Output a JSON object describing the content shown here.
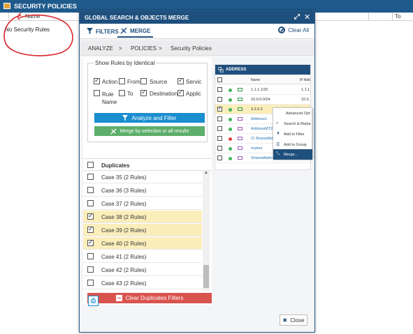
{
  "background": {
    "header_title": "SECURITY POLICIES",
    "col_name": "Name",
    "col_to": "To",
    "empty_text": "No Security Rules"
  },
  "modal": {
    "title": "GLOBAL SEARCH & OBJECTS MERGE",
    "tabs": {
      "filters": "FILTERS",
      "merge": "MERGE"
    },
    "clear_all": "Clear All",
    "breadcrumb": [
      "ANALYZE",
      ">",
      "POLICIES",
      ">",
      "Security Policies"
    ],
    "show_rules": {
      "legend": "Show Rules by Identical",
      "options": [
        {
          "label": "Action",
          "checked": true
        },
        {
          "label": "From",
          "checked": false
        },
        {
          "label": "Source",
          "checked": false
        },
        {
          "label": "Servic",
          "checked": true
        },
        {
          "label": "Rule Name",
          "checked": false
        },
        {
          "label": "To",
          "checked": false
        },
        {
          "label": "Destination",
          "checked": true
        },
        {
          "label": "Applic",
          "checked": true
        }
      ],
      "analyze_button": "Analyze and Filter",
      "merge_button": "Merge by selection or all results"
    },
    "duplicates": {
      "header": "Duplicates",
      "rows": [
        {
          "label": "Case 35 (2 Rules)",
          "checked": false
        },
        {
          "label": "Case 36 (3 Rules)",
          "checked": false
        },
        {
          "label": "Case 37 (2 Rules)",
          "checked": false
        },
        {
          "label": "Case 38 (2 Rules)",
          "checked": true
        },
        {
          "label": "Case 39 (2 Rules)",
          "checked": true
        },
        {
          "label": "Case 40 (2 Rules)",
          "checked": true
        },
        {
          "label": "Case 41 (2 Rules)",
          "checked": false
        },
        {
          "label": "Case 42 (2 Rules)",
          "checked": false
        },
        {
          "label": "Case 43 (2 Rules)",
          "checked": false
        }
      ],
      "clear_button": "Clear Duplicates Filters"
    },
    "address": {
      "header": "ADDRESS",
      "col_name": "Name",
      "col_ip": "IP Add",
      "rows": [
        {
          "name": "1.1.1.1/32",
          "ip": "1.1.1",
          "status": "green",
          "kind": "host",
          "checked": false,
          "link": false
        },
        {
          "name": "10.0.0.0/24",
          "ip": "10.0.",
          "status": "green",
          "kind": "host",
          "checked": false,
          "link": false
        },
        {
          "name": "3.3.3.3",
          "ip": "3.3.3",
          "status": "green",
          "kind": "host",
          "checked": true,
          "link": false
        },
        {
          "name": "Address1",
          "ip": "",
          "status": "green",
          "kind": "group",
          "checked": false,
          "link": true
        },
        {
          "name": "AddressMT2",
          "ip": "",
          "status": "green",
          "kind": "group",
          "checked": false,
          "link": true
        },
        {
          "name": "Cl SharedAdd",
          "ip": "",
          "status": "red",
          "kind": "group",
          "checked": false,
          "link": true
        },
        {
          "name": "mytest",
          "ip": "",
          "status": "green",
          "kind": "group",
          "checked": false,
          "link": true
        },
        {
          "name": "SharedAddres",
          "ip": "",
          "status": "green",
          "kind": "group",
          "checked": false,
          "link": true
        }
      ]
    },
    "context_menu": [
      {
        "label": "Advanced Opt",
        "icon": ""
      },
      {
        "label": "Search & Repla",
        "icon": "search-icon"
      },
      {
        "label": "Add to Filter",
        "icon": "filter-icon"
      },
      {
        "label": "Add to Group",
        "icon": "list-icon"
      },
      {
        "label": "Merge...",
        "icon": "merge-icon"
      }
    ],
    "close_button": "Close"
  },
  "colors": {
    "header_blue": "#1f4f7d",
    "accent_blue": "#1b8ed0",
    "green": "#5cae6a",
    "red": "#d9534f",
    "selected_row": "#fbeebb"
  }
}
